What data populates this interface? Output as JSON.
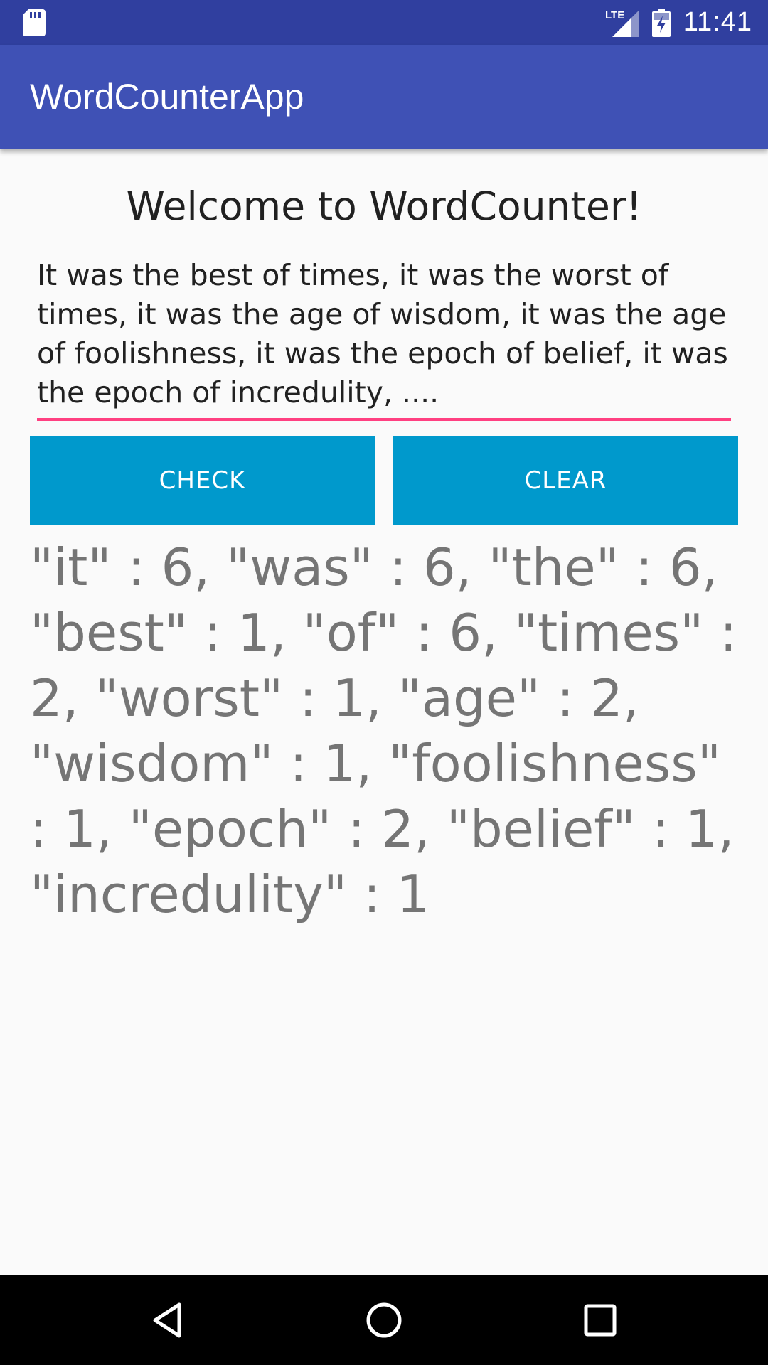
{
  "status_bar": {
    "time": "11:41",
    "network_label": "LTE",
    "icons": [
      "sd-card-icon",
      "lte-signal-icon",
      "battery-charging-icon"
    ]
  },
  "app_bar": {
    "title": "WordCounterApp"
  },
  "main": {
    "welcome": "Welcome to WordCounter!",
    "input_text": "It was the best of times, it was the worst of times, it was the age of wisdom, it was the age of foolishness, it was the epoch of belief, it was the epoch of incredulity, ....",
    "check_label": "CHECK",
    "clear_label": "CLEAR",
    "result_text": "\"it\" : 6, \"was\" : 6, \"the\" : 6, \"best\" : 1, \"of\" : 6, \"times\" : 2, \"worst\" : 1, \"age\" : 2, \"wisdom\" : 1, \"foolishness\" : 1, \"epoch\" : 2, \"belief\" : 1, \"incredulity\" : 1"
  },
  "nav_bar": {
    "icons": [
      "back-icon",
      "home-icon",
      "recents-icon"
    ]
  },
  "colors": {
    "status_bar": "#303f9f",
    "primary": "#3f51b5",
    "accent": "#ff4081",
    "button": "#0099cc",
    "background": "#fafafa",
    "result_text": "#757575"
  }
}
